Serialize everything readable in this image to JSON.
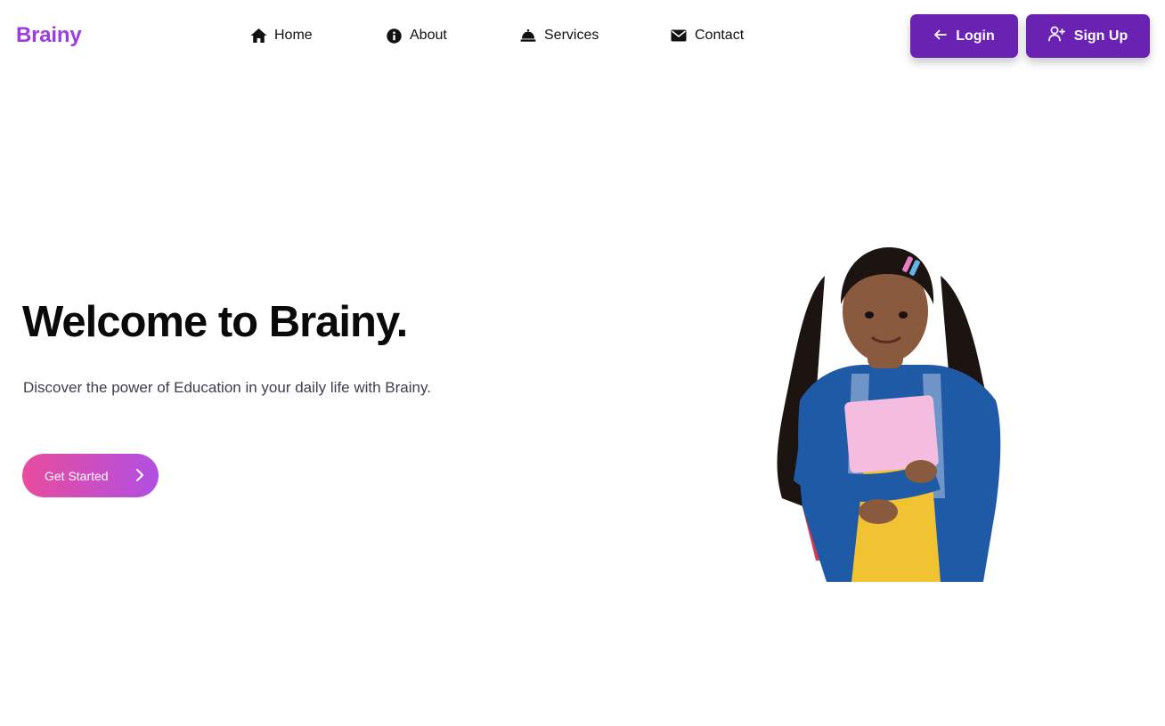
{
  "brand": {
    "name": "Brainy",
    "color": "#9b3de0"
  },
  "nav": {
    "items": [
      {
        "label": "Home",
        "icon": "home-icon"
      },
      {
        "label": "About",
        "icon": "info-icon"
      },
      {
        "label": "Services",
        "icon": "bell-icon"
      },
      {
        "label": "Contact",
        "icon": "envelope-icon"
      }
    ]
  },
  "auth": {
    "login_label": "Login",
    "login_icon": "arrow-left-icon",
    "signup_label": "Sign Up",
    "signup_icon": "user-plus-icon",
    "button_color": "#6a22b3"
  },
  "hero": {
    "title": "Welcome to Brainy.",
    "subtitle": "Discover the power of Education in your daily life with Brainy.",
    "cta_label": "Get Started",
    "cta_icon": "chevron-right-icon",
    "cta_gradient": [
      "#e84c9e",
      "#b14fe2"
    ],
    "image_subject": "student girl holding pink notebook with backpack"
  }
}
